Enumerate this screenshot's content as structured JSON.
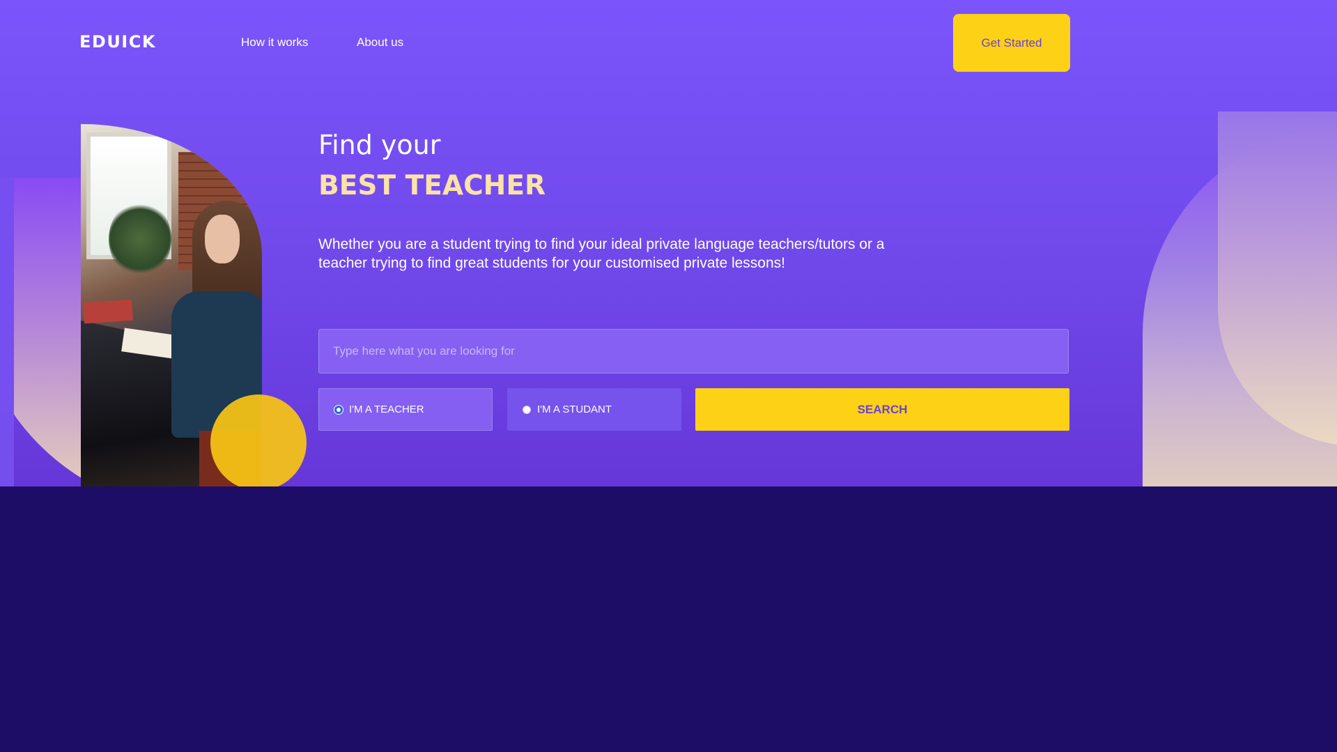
{
  "header": {
    "logo_text": "EDUICK",
    "nav": [
      {
        "label": "How it works"
      },
      {
        "label": "About us"
      }
    ],
    "cta_label": "Get Started"
  },
  "hero": {
    "title_line1": "Find your",
    "title_line2": "BEST TEACHER",
    "description": "Whether you are a student trying to find your ideal private language teachers/tutors or a teacher trying to find great students for your customised private lessons!",
    "search": {
      "placeholder": "Type here what you are looking for",
      "value": ""
    },
    "roles": [
      {
        "label": "I'M A TEACHER",
        "selected": true
      },
      {
        "label": "I'M A STUDANT",
        "selected": false
      }
    ],
    "search_button_label": "SEARCH"
  },
  "colors": {
    "hero_bg": "#7b55fb",
    "page_bg": "#1e0d66",
    "accent_yellow": "#fcd116",
    "headline_accent": "#fbe3a8"
  }
}
